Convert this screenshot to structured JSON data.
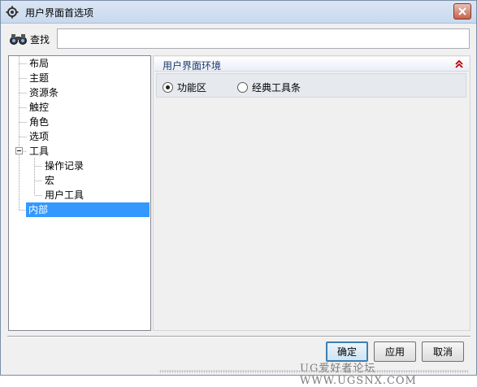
{
  "window": {
    "title": "用户界面首选项"
  },
  "search": {
    "label": "查找",
    "value": "",
    "placeholder": ""
  },
  "tree": {
    "items": [
      {
        "label": "布局",
        "level": 0
      },
      {
        "label": "主题",
        "level": 0
      },
      {
        "label": "资源条",
        "level": 0
      },
      {
        "label": "触控",
        "level": 0
      },
      {
        "label": "角色",
        "level": 0
      },
      {
        "label": "选项",
        "level": 0
      },
      {
        "label": "工具",
        "level": 0,
        "expanded": true
      },
      {
        "label": "操作记录",
        "level": 1
      },
      {
        "label": "宏",
        "level": 1
      },
      {
        "label": "用户工具",
        "level": 1
      },
      {
        "label": "内部",
        "level": 0,
        "selected": true
      }
    ]
  },
  "panel": {
    "group_title": "用户界面环境",
    "options": [
      {
        "label": "功能区",
        "checked": true
      },
      {
        "label": "经典工具条",
        "checked": false
      }
    ]
  },
  "buttons": {
    "ok": "确定",
    "apply": "应用",
    "cancel": "取消"
  },
  "watermark": "UG爱好者论坛 WWW.UGSNX.COM",
  "colors": {
    "selection": "#3399ff",
    "collapse_icon": "#c00000"
  }
}
